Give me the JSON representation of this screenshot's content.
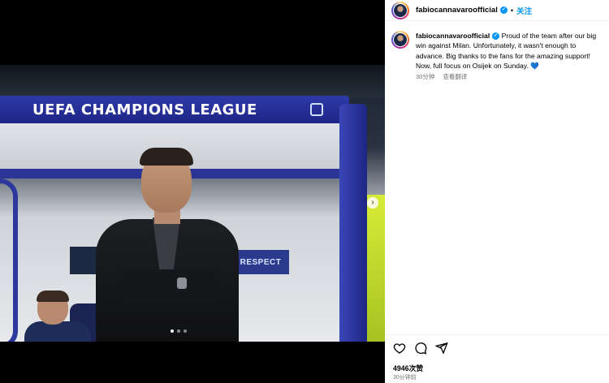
{
  "photo": {
    "banner_text": "UEFA CHAMPIONS LEAGUE",
    "respect_text": "RESPECT",
    "next_glyph": "›",
    "carousel": {
      "count": 3,
      "active_index": 0
    }
  },
  "header": {
    "username": "fabiocannavaroofficial",
    "separator": "•",
    "follow_label": "关注"
  },
  "caption": {
    "username": "fabiocannavaroofficial",
    "text": "Proud of the team after our big win against Milan. Unfortunately, it wasn't enough to advance. Big thanks to the fans for the amazing support! Now, full focus on Osijek on Sunday.",
    "emoji": "💙",
    "time": "30分钟",
    "translate_label": "查看翻译"
  },
  "actions": {
    "icons": [
      "heart-icon",
      "comment-icon",
      "share-icon"
    ],
    "likes": "4946次赞",
    "time": "30分钟前"
  },
  "colors": {
    "accent": "#0095f6",
    "banner": "#2f3aa8",
    "meta_text": "#737373"
  }
}
